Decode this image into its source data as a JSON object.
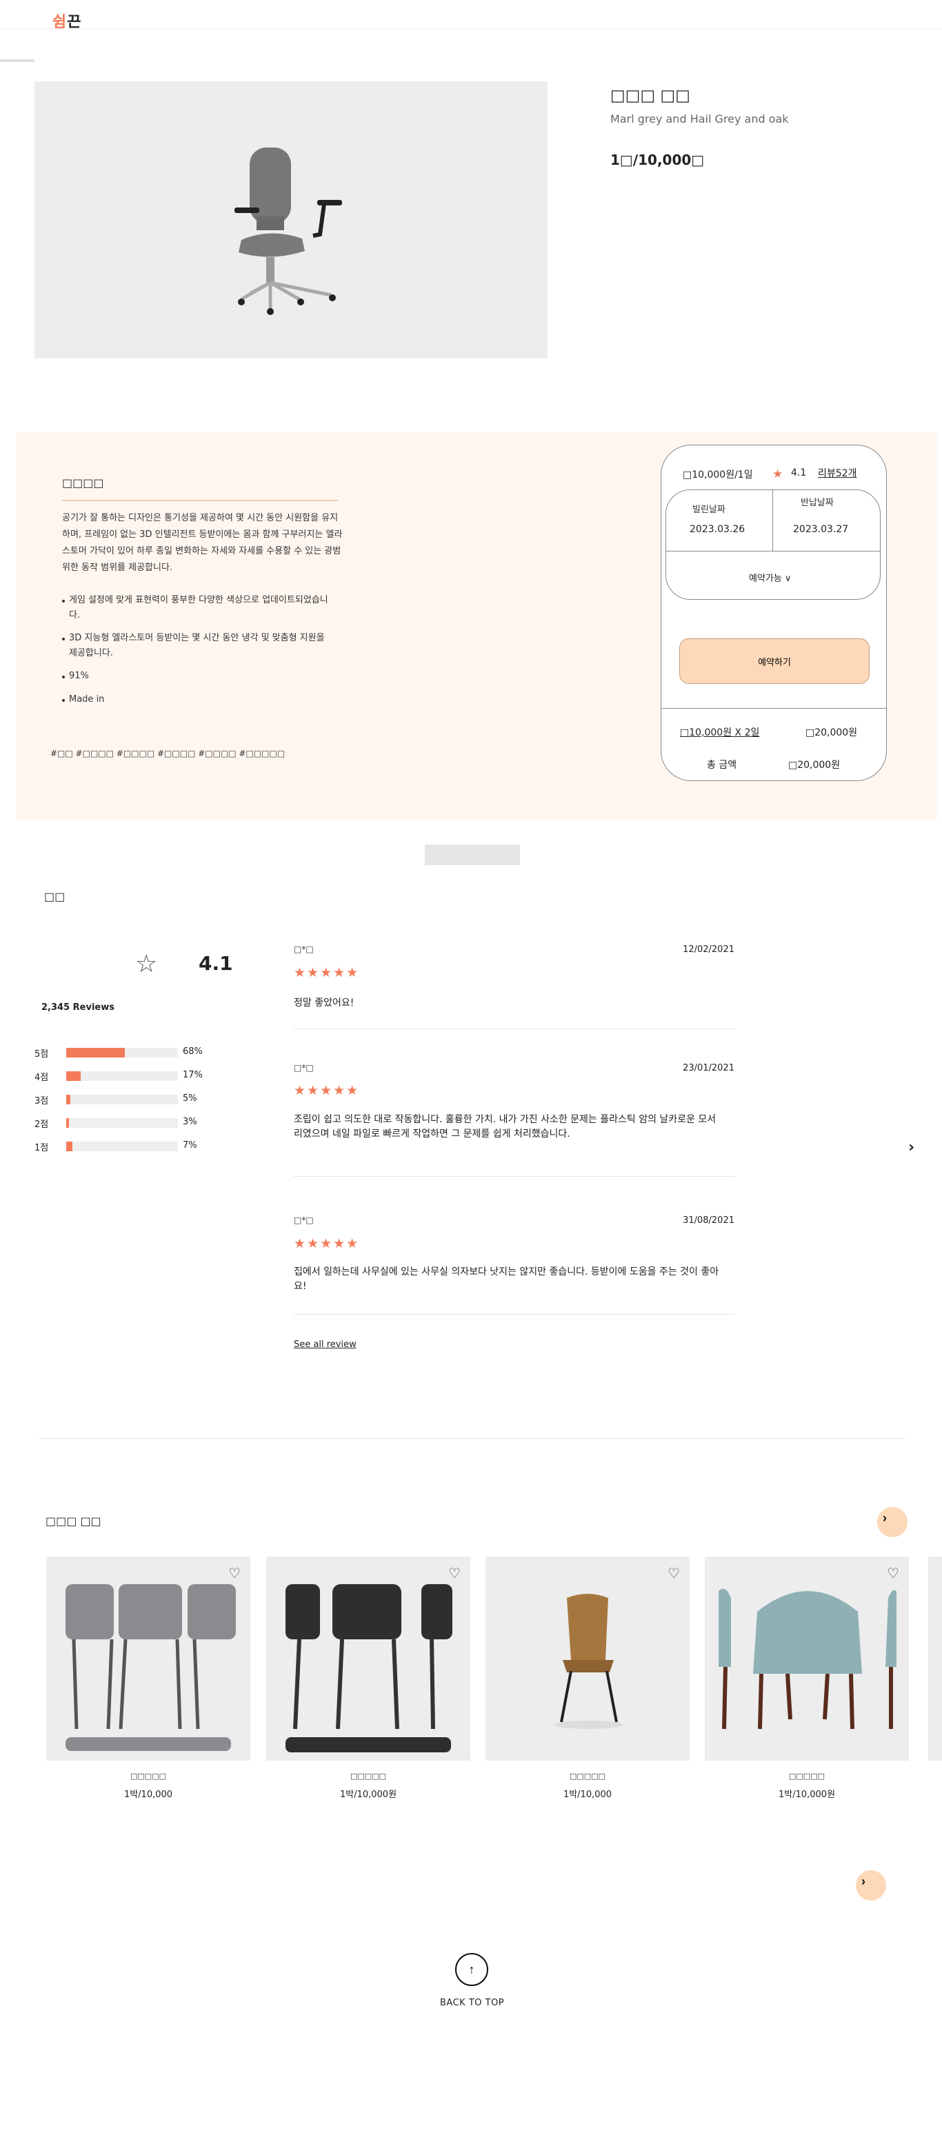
{
  "header": {
    "logo_a": "쉼",
    "logo_b": "끈"
  },
  "product": {
    "title": "□□□ □□",
    "subtitle": "Marl grey and Hail Grey and oak",
    "price": "1□/10,000□"
  },
  "details": {
    "title": "□□□□",
    "description": "공기가 잘 통하는 디자인은 통기성을 제공하여 몇 시간 동안 시원함을 유지하며, 프레임이 없는 3D 인텔리전트 등받이에는 몸과 함께 구부러지는 엘라스토머 가닥이 있어 하루 종일 변화하는 자세와 자세를 수용할 수 있는 광범위한 동작 범위를 제공합니다.",
    "bullets": [
      "게임 설정에 맞게 표현력이 풍부한 다양한 색상으로 업데이트되었습니다.",
      "3D 지능형 엘라스토머 등받이는 몇 시간 동안 냉각 및 맞춤형 지원을 제공합니다.",
      "91%",
      "Made in"
    ],
    "tags": "#□□ #□□□□ #□□□□ #□□□□ #□□□□ #□□□□□"
  },
  "booking": {
    "price_per_day": "□10,000원/1일",
    "rating": "4.1",
    "reviews_link": "리뷰52개",
    "rent_label": "빌린날짜",
    "rent_date": "2023.03.26",
    "return_label": "반납날짜",
    "return_date": "2023.03.27",
    "availability": "예약가능  ∨",
    "reserve_button": "예약하기",
    "calc": "□10,000원 X 2일",
    "calc_total": "□20,000원",
    "total_label": "총 금액",
    "total_value": "□20,000원"
  },
  "reviews": {
    "title": "□□",
    "average": "4.1",
    "count": "2,345 Reviews",
    "distribution": [
      {
        "label": "5점",
        "pct": "68%",
        "value": 0.68
      },
      {
        "label": "4점",
        "pct": "17%",
        "value": 0.17
      },
      {
        "label": "3점",
        "pct": "5%",
        "value": 0.05
      },
      {
        "label": "2점",
        "pct": "3%",
        "value": 0.03
      },
      {
        "label": "1점",
        "pct": "7%",
        "value": 0.07
      }
    ],
    "items": [
      {
        "name": "□*□",
        "date": "12/02/2021",
        "stars": "★★★★★",
        "text": "정말 좋았어요!"
      },
      {
        "name": "□*□",
        "date": "23/01/2021",
        "stars": "★★★★★",
        "text": "조립이 쉽고 의도한 대로 작동합니다. 훌륭한 가치. 내가 가진 사소한 문제는 플라스틱 암의 날카로운 모서리였으며 네일 파일로 빠르게 작업하면 그 문제를 쉽게 처리했습니다."
      },
      {
        "name": "□*□",
        "date": "31/08/2021",
        "stars": "★★★★★",
        "text": "집에서 일하는데 사무실에 있는 사무실 의자보다 낫지는 않지만  좋습니다. 등받이에 도움을 주는 것이 좋아요!"
      }
    ],
    "see_all": "See all review",
    "next_icon": "›"
  },
  "recommend": {
    "title": "□□□ □□",
    "items": [
      {
        "name": "□□□□□",
        "price": "1박/10,000"
      },
      {
        "name": "□□□□□",
        "price": "1박/10,000원"
      },
      {
        "name": "□□□□□",
        "price": "1박/10,000"
      },
      {
        "name": "□□□□□",
        "price": "1박/10,000원"
      }
    ]
  },
  "footer": {
    "back_to_top": "BACK TO TOP"
  },
  "colors": {
    "accent": "#f47b58",
    "peach": "#fdd9b9",
    "band": "#fff6f0"
  }
}
